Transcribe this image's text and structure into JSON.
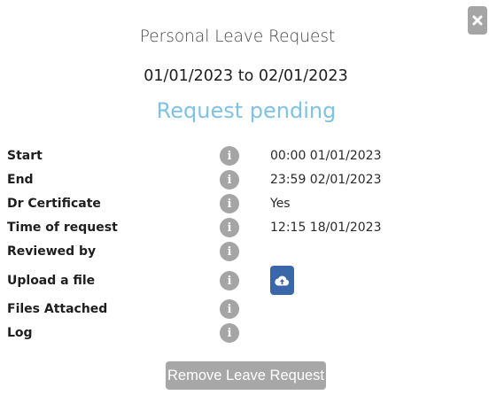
{
  "dialog": {
    "title": "Personal Leave Request",
    "date_range": "01/01/2023 to 02/01/2023",
    "status": "Request pending",
    "info_glyph": "i"
  },
  "details": {
    "start": {
      "label": "Start",
      "value": "00:00 01/01/2023"
    },
    "end": {
      "label": "End",
      "value": "23:59 02/01/2023"
    },
    "dr_certificate": {
      "label": "Dr Certificate",
      "value": "Yes"
    },
    "time_of_request": {
      "label": "Time of request",
      "value": "12:15 18/01/2023"
    },
    "reviewed_by": {
      "label": "Reviewed by",
      "value": ""
    },
    "upload_file": {
      "label": "Upload a file"
    },
    "files_attached": {
      "label": "Files Attached",
      "value": ""
    },
    "log": {
      "label": "Log",
      "value": ""
    }
  },
  "actions": {
    "remove_label": "Remove Leave Request"
  },
  "icons": {
    "close": "close-icon",
    "info": "info-icon",
    "upload": "cloud-upload-icon"
  },
  "colors": {
    "status": "#7fc2e3",
    "upload_button": "#3a67a9",
    "muted_button": "#a7a7a7",
    "info_icon": "#a5a5a5"
  }
}
